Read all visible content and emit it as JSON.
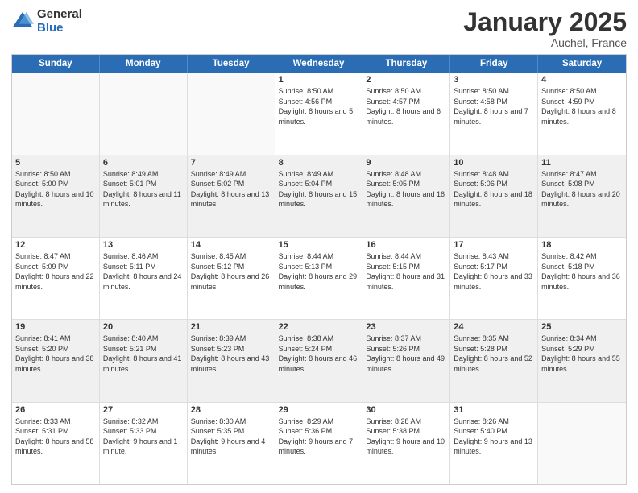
{
  "header": {
    "logo_general": "General",
    "logo_blue": "Blue",
    "title": "January 2025",
    "subtitle": "Auchel, France"
  },
  "calendar": {
    "days_of_week": [
      "Sunday",
      "Monday",
      "Tuesday",
      "Wednesday",
      "Thursday",
      "Friday",
      "Saturday"
    ],
    "rows": [
      [
        {
          "day": "",
          "empty": true
        },
        {
          "day": "",
          "empty": true
        },
        {
          "day": "",
          "empty": true
        },
        {
          "day": "1",
          "sunrise": "8:50 AM",
          "sunset": "4:56 PM",
          "daylight": "8 hours and 5 minutes."
        },
        {
          "day": "2",
          "sunrise": "8:50 AM",
          "sunset": "4:57 PM",
          "daylight": "8 hours and 6 minutes."
        },
        {
          "day": "3",
          "sunrise": "8:50 AM",
          "sunset": "4:58 PM",
          "daylight": "8 hours and 7 minutes."
        },
        {
          "day": "4",
          "sunrise": "8:50 AM",
          "sunset": "4:59 PM",
          "daylight": "8 hours and 8 minutes."
        }
      ],
      [
        {
          "day": "5",
          "sunrise": "8:50 AM",
          "sunset": "5:00 PM",
          "daylight": "8 hours and 10 minutes."
        },
        {
          "day": "6",
          "sunrise": "8:49 AM",
          "sunset": "5:01 PM",
          "daylight": "8 hours and 11 minutes."
        },
        {
          "day": "7",
          "sunrise": "8:49 AM",
          "sunset": "5:02 PM",
          "daylight": "8 hours and 13 minutes."
        },
        {
          "day": "8",
          "sunrise": "8:49 AM",
          "sunset": "5:04 PM",
          "daylight": "8 hours and 15 minutes."
        },
        {
          "day": "9",
          "sunrise": "8:48 AM",
          "sunset": "5:05 PM",
          "daylight": "8 hours and 16 minutes."
        },
        {
          "day": "10",
          "sunrise": "8:48 AM",
          "sunset": "5:06 PM",
          "daylight": "8 hours and 18 minutes."
        },
        {
          "day": "11",
          "sunrise": "8:47 AM",
          "sunset": "5:08 PM",
          "daylight": "8 hours and 20 minutes."
        }
      ],
      [
        {
          "day": "12",
          "sunrise": "8:47 AM",
          "sunset": "5:09 PM",
          "daylight": "8 hours and 22 minutes."
        },
        {
          "day": "13",
          "sunrise": "8:46 AM",
          "sunset": "5:11 PM",
          "daylight": "8 hours and 24 minutes."
        },
        {
          "day": "14",
          "sunrise": "8:45 AM",
          "sunset": "5:12 PM",
          "daylight": "8 hours and 26 minutes."
        },
        {
          "day": "15",
          "sunrise": "8:44 AM",
          "sunset": "5:13 PM",
          "daylight": "8 hours and 29 minutes."
        },
        {
          "day": "16",
          "sunrise": "8:44 AM",
          "sunset": "5:15 PM",
          "daylight": "8 hours and 31 minutes."
        },
        {
          "day": "17",
          "sunrise": "8:43 AM",
          "sunset": "5:17 PM",
          "daylight": "8 hours and 33 minutes."
        },
        {
          "day": "18",
          "sunrise": "8:42 AM",
          "sunset": "5:18 PM",
          "daylight": "8 hours and 36 minutes."
        }
      ],
      [
        {
          "day": "19",
          "sunrise": "8:41 AM",
          "sunset": "5:20 PM",
          "daylight": "8 hours and 38 minutes."
        },
        {
          "day": "20",
          "sunrise": "8:40 AM",
          "sunset": "5:21 PM",
          "daylight": "8 hours and 41 minutes."
        },
        {
          "day": "21",
          "sunrise": "8:39 AM",
          "sunset": "5:23 PM",
          "daylight": "8 hours and 43 minutes."
        },
        {
          "day": "22",
          "sunrise": "8:38 AM",
          "sunset": "5:24 PM",
          "daylight": "8 hours and 46 minutes."
        },
        {
          "day": "23",
          "sunrise": "8:37 AM",
          "sunset": "5:26 PM",
          "daylight": "8 hours and 49 minutes."
        },
        {
          "day": "24",
          "sunrise": "8:35 AM",
          "sunset": "5:28 PM",
          "daylight": "8 hours and 52 minutes."
        },
        {
          "day": "25",
          "sunrise": "8:34 AM",
          "sunset": "5:29 PM",
          "daylight": "8 hours and 55 minutes."
        }
      ],
      [
        {
          "day": "26",
          "sunrise": "8:33 AM",
          "sunset": "5:31 PM",
          "daylight": "8 hours and 58 minutes."
        },
        {
          "day": "27",
          "sunrise": "8:32 AM",
          "sunset": "5:33 PM",
          "daylight": "9 hours and 1 minute."
        },
        {
          "day": "28",
          "sunrise": "8:30 AM",
          "sunset": "5:35 PM",
          "daylight": "9 hours and 4 minutes."
        },
        {
          "day": "29",
          "sunrise": "8:29 AM",
          "sunset": "5:36 PM",
          "daylight": "9 hours and 7 minutes."
        },
        {
          "day": "30",
          "sunrise": "8:28 AM",
          "sunset": "5:38 PM",
          "daylight": "9 hours and 10 minutes."
        },
        {
          "day": "31",
          "sunrise": "8:26 AM",
          "sunset": "5:40 PM",
          "daylight": "9 hours and 13 minutes."
        },
        {
          "day": "",
          "empty": true
        }
      ]
    ]
  }
}
